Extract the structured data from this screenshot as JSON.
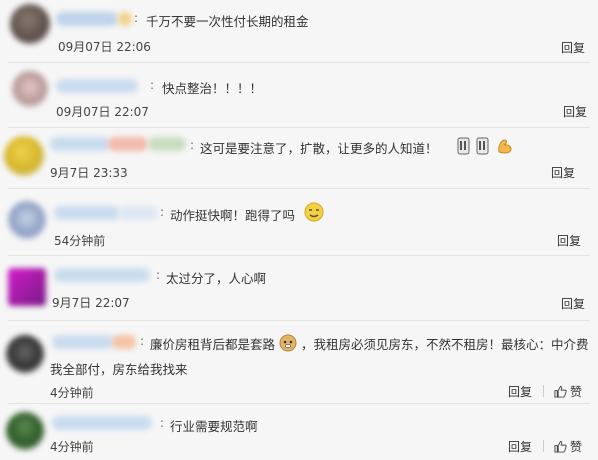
{
  "comments": [
    {
      "text": "千万不要一次性付长期的租金",
      "time": "09月07日 22:06",
      "reply": "回复"
    },
    {
      "text": "快点整治！！！！",
      "time": "09月07日 22:07",
      "reply": "回复"
    },
    {
      "text": "这可是要注意了，扩散，让更多的人知道！",
      "time": "9月7日 23:33",
      "reply": "回复"
    },
    {
      "text": "动作挺快啊！跑得了吗",
      "time": "54分钟前",
      "reply": "回复"
    },
    {
      "text": "太过分了，人心啊",
      "time": "9月7日 22:07",
      "reply": "回复"
    },
    {
      "text_a": "廉价房租背后都是套路",
      "text_b": "，我租房必须见房东，不然不租房！最核心：中介费",
      "text_c": "我全部付，房东给我找来",
      "time": "4分钟前",
      "reply": "回复",
      "like": "赞"
    },
    {
      "text": "行业需要规范啊",
      "time": "4分钟前",
      "reply": "回复",
      "like": "赞"
    }
  ],
  "colors": {
    "background": "#f6f6f6",
    "separator": "#e3e3e3"
  },
  "icons": [
    "avatar",
    "emoji-candle",
    "emoji-muscle",
    "emoji-sweat",
    "emoji-doge",
    "thumbs-up-icon"
  ]
}
